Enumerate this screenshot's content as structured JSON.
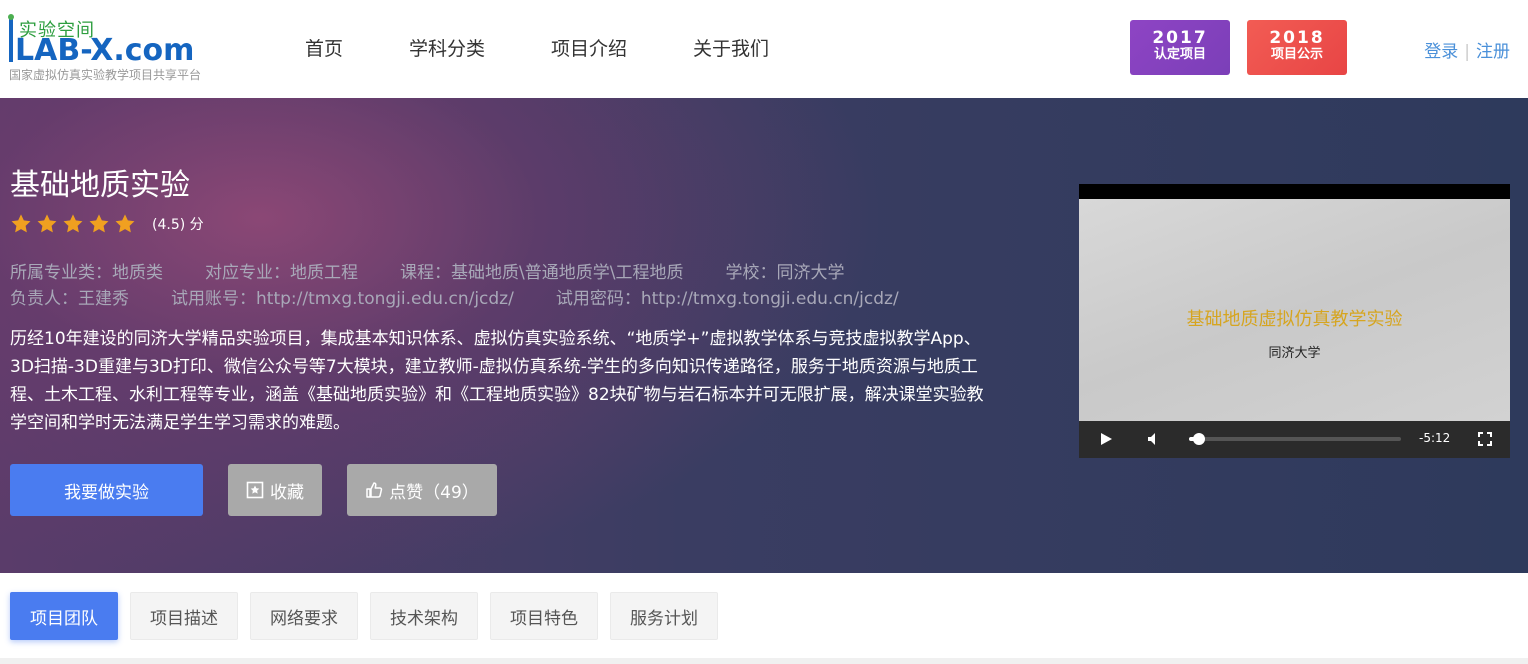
{
  "logo": {
    "top": "实验空间",
    "main": "LAB-X.com",
    "sub": "国家虚拟仿真实验教学项目共享平台"
  },
  "nav": [
    "首页",
    "学科分类",
    "项目介绍",
    "关于我们"
  ],
  "badges": [
    {
      "year": "2017",
      "label": "认定项目",
      "color": "#8e44c4"
    },
    {
      "year": "2018",
      "label": "项目公示",
      "color": "#f25c54"
    }
  ],
  "auth": {
    "login": "登录",
    "sep": "|",
    "register": "注册"
  },
  "project": {
    "title": "基础地质实验",
    "rating": 4.5,
    "rating_text": "(4.5) 分",
    "meta_line1": [
      "所属专业类：地质类",
      "对应专业：地质工程",
      "课程：基础地质\\普通地质学\\工程地质",
      "学校：同济大学"
    ],
    "meta_line2": [
      "负责人：王建秀",
      "试用账号：http://tmxg.tongji.edu.cn/jcdz/",
      "试用密码：http://tmxg.tongji.edu.cn/jcdz/"
    ],
    "description": "历经10年建设的同济大学精品实验项目，集成基本知识体系、虚拟仿真实验系统、“地质学+”虚拟教学体系与竞技虚拟教学App、3D扫描-3D重建与3D打印、微信公众号等7大模块，建立教师-虚拟仿真系统-学生的多向知识传递路径，服务于地质资源与地质工程、土木工程、水利工程等专业，涵盖《基础地质实验》和《工程地质实验》82块矿物与岩石标本并可无限扩展，解决课堂实验教学空间和学时无法满足学生学习需求的难题。"
  },
  "buttons": {
    "start": "我要做实验",
    "favorite": "收藏",
    "like": "点赞（49）"
  },
  "video": {
    "title": "基础地质虚拟仿真教学实验",
    "subtitle": "同济大学",
    "time": "-5:12",
    "progress": 0.04
  },
  "tabs": [
    "项目团队",
    "项目描述",
    "网络要求",
    "技术架构",
    "项目特色",
    "服务计划"
  ],
  "colors": {
    "primary": "#4a7cf0",
    "star": "#f0a020",
    "link": "#4a90d9"
  }
}
